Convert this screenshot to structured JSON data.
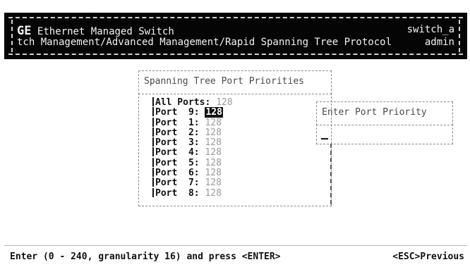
{
  "header": {
    "brand": "GE",
    "title": "Ethernet Managed Switch",
    "path": "tch Management/Advanced Management/Rapid Spanning Tree Protocol",
    "switch_name": "switch_a",
    "user": "admin"
  },
  "priorities_panel": {
    "title": "Spanning Tree Port Priorities",
    "all_ports_label": "All Ports:",
    "all_ports_value": "128",
    "ports": [
      {
        "label": "Port  9:",
        "value": "128",
        "selected": true
      },
      {
        "label": "Port  1:",
        "value": "128",
        "selected": false
      },
      {
        "label": "Port  2:",
        "value": "128",
        "selected": false
      },
      {
        "label": "Port  3:",
        "value": "128",
        "selected": false
      },
      {
        "label": "Port  4:",
        "value": "128",
        "selected": false
      },
      {
        "label": "Port  5:",
        "value": "128",
        "selected": false
      },
      {
        "label": "Port  6:",
        "value": "128",
        "selected": false
      },
      {
        "label": "Port  7:",
        "value": "128",
        "selected": false
      },
      {
        "label": "Port  8:",
        "value": "128",
        "selected": false
      }
    ]
  },
  "entry_panel": {
    "title": "Enter Port Priority",
    "input_value": ""
  },
  "footer": {
    "hint": "Enter (0 - 240, granularity 16) and press <ENTER>",
    "esc": "<ESC>Previous"
  }
}
